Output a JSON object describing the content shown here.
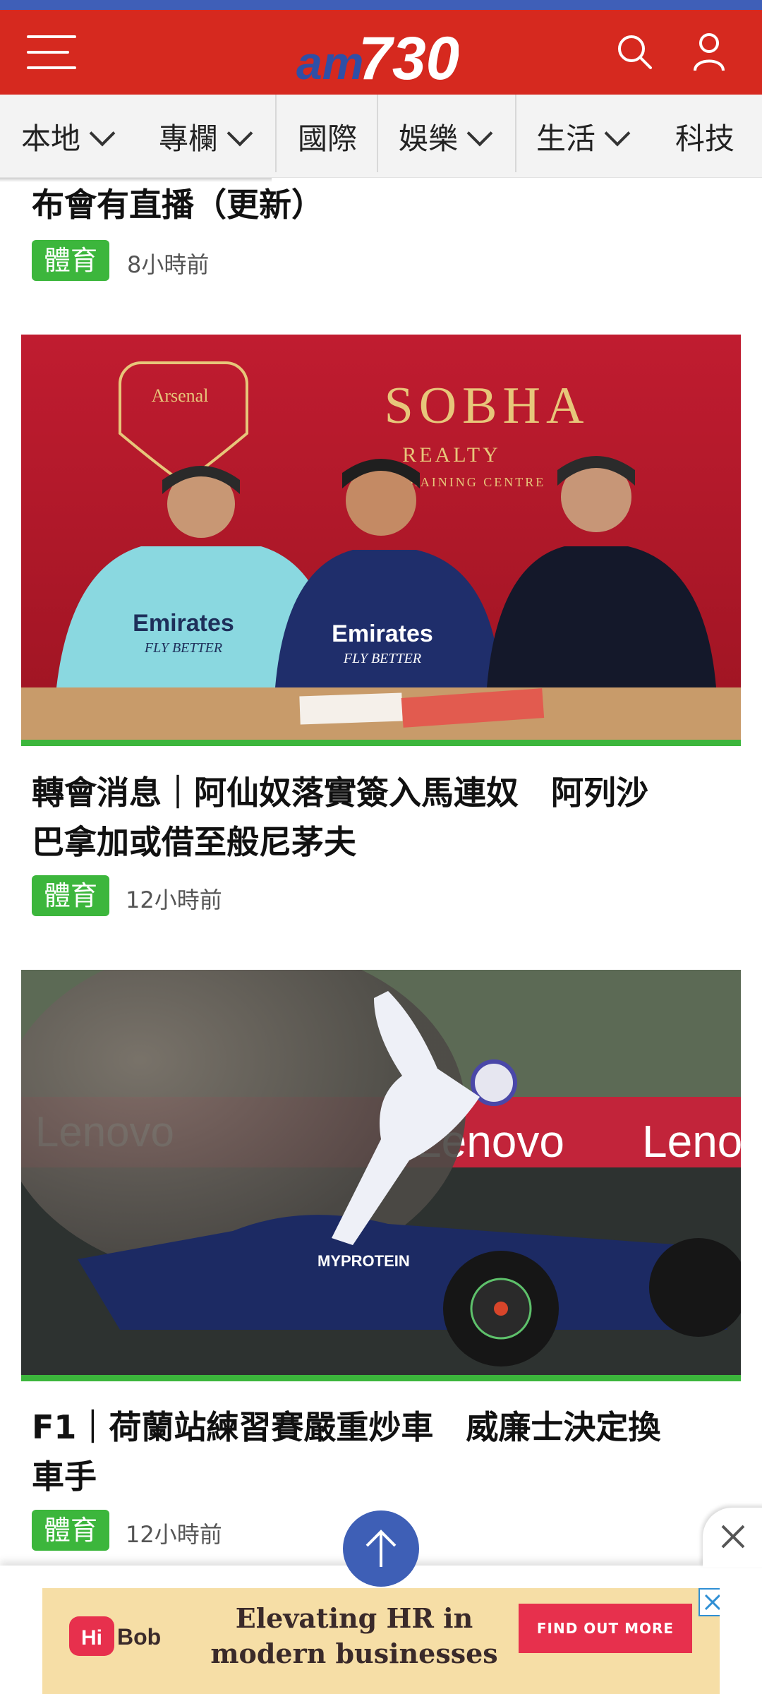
{
  "header": {
    "logo_text_am": "am",
    "logo_text_num": "730",
    "brand_color": "#d6291f"
  },
  "categories": [
    {
      "label": "本地",
      "dropdown": true
    },
    {
      "label": "專欄",
      "dropdown": true
    },
    {
      "label": "國際",
      "dropdown": false
    },
    {
      "label": "娛樂",
      "dropdown": true
    },
    {
      "label": "生活",
      "dropdown": true
    },
    {
      "label": "科技",
      "dropdown": false
    }
  ],
  "articles": [
    {
      "title_partial": "布會有直播（更新）",
      "tag": "體育",
      "time": "8小時前"
    },
    {
      "image_text": {
        "club": "Arsenal",
        "sponsor": "SOBHA",
        "sponsor_sub": "REALTY",
        "sponsor_sub2": "TRAINING CENTRE",
        "shirt": "Emirates",
        "shirt_sub": "FLY BETTER"
      },
      "title_line1": "轉會消息｜阿仙奴落實簽入馬連奴　阿列沙",
      "title_line2": "巴拿加或借至般尼茅夫",
      "tag": "體育",
      "time": "12小時前"
    },
    {
      "image_text": {
        "banner": "Lenovo",
        "car_sponsor": "MYPROTEIN"
      },
      "title_line1": "F1｜荷蘭站練習賽嚴重炒車　威廉士決定換",
      "title_line2": "車手",
      "tag": "體育",
      "time": "12小時前"
    }
  ],
  "ad": {
    "brand_hi": "Hi",
    "brand_bob": "Bob",
    "line1": "Elevating HR in",
    "line2": "modern businesses",
    "cta": "FIND OUT MORE"
  },
  "colors": {
    "tag_green": "#3cb63c",
    "top_strip": "#3f5fb8",
    "back_to_top": "#3e5fb6"
  }
}
